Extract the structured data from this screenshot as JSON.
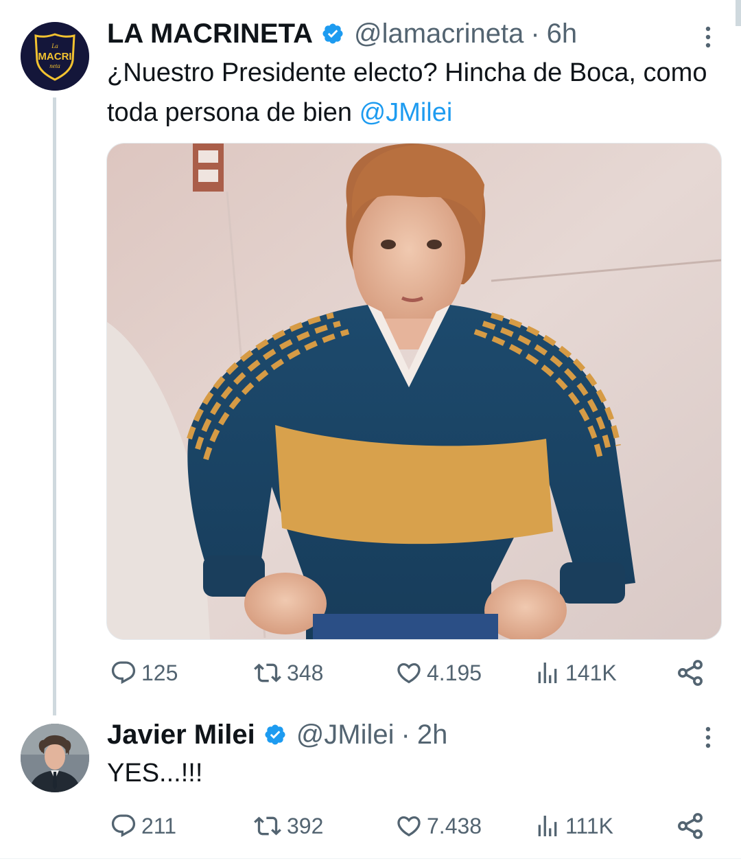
{
  "colors": {
    "accent": "#1d9bf0",
    "secondary_text": "#536471",
    "primary_text": "#0f1419",
    "thread_line": "#cfd9de"
  },
  "tweets": [
    {
      "avatar": {
        "logo_text_top": "La",
        "logo_text_main": "MACRI",
        "logo_text_bottom": "neta",
        "icon": "shield-logo"
      },
      "display_name": "LA MACRINETA",
      "verified": true,
      "handle": "@lamacrineta",
      "separator": "·",
      "time": "6h",
      "text_main": "¿Nuestro Presidente electo? Hincha de Boca, como toda persona de bien ",
      "mention": "@JMilei",
      "media": {
        "type": "photo",
        "icon": "photo-boy-boca-jersey"
      },
      "actions": {
        "replies": "125",
        "retweets": "348",
        "likes": "4.195",
        "views": "141K"
      }
    },
    {
      "avatar": {
        "icon": "person-portrait"
      },
      "display_name": "Javier Milei",
      "verified": true,
      "handle": "@JMilei",
      "separator": "·",
      "time": "2h",
      "text_main": "YES...!!!",
      "actions": {
        "replies": "211",
        "retweets": "392",
        "likes": "7.438",
        "views": "111K"
      }
    }
  ]
}
